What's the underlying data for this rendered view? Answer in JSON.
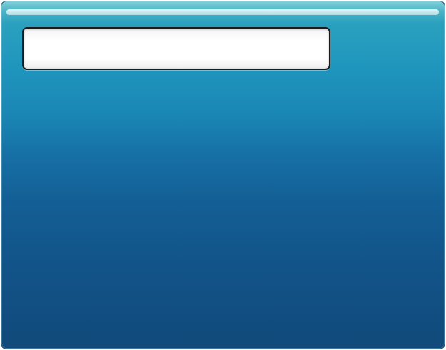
{
  "panel": {
    "text_field": {
      "value": "",
      "placeholder": ""
    }
  },
  "colors": {
    "panel_top": "#7fcfd8",
    "panel_mid": "#1a86b4",
    "panel_bottom": "#11497a",
    "panel_border": "#0f3f5f",
    "field_background": "#ffffff",
    "field_border": "#1b1b1b"
  }
}
